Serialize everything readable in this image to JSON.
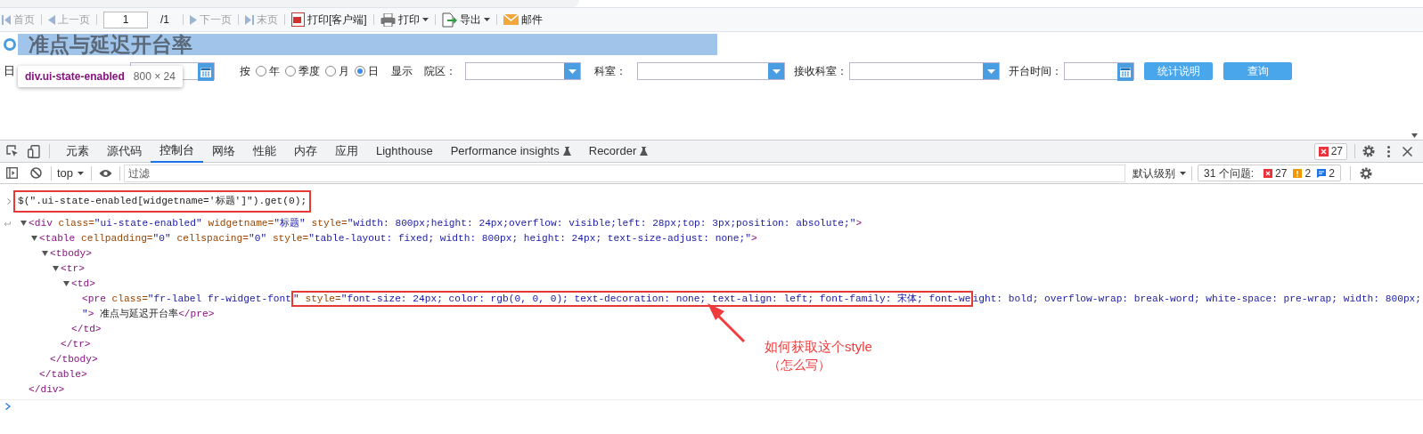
{
  "report_toolbar": {
    "items": [
      {
        "label": "首页",
        "disabled": true
      },
      {
        "label": "上一页",
        "disabled": true
      },
      {
        "kind": "page",
        "value": "1",
        "total": "/1"
      },
      {
        "label": "下一页",
        "disabled": true
      },
      {
        "label": "末页",
        "disabled": true
      },
      {
        "label": "打印[客户端]",
        "disabled": false
      },
      {
        "label": "打印",
        "disabled": false,
        "menu": true
      },
      {
        "label": "导出",
        "disabled": false,
        "menu": true
      },
      {
        "label": "邮件",
        "disabled": false
      }
    ]
  },
  "title": {
    "text": "准点与延迟开台率"
  },
  "tooltip": {
    "selector": "div.ui-state-enabled",
    "size": "800 × 24"
  },
  "filters": {
    "date_label": "日",
    "group_label": "按",
    "periods": [
      {
        "label": "年",
        "selected": false
      },
      {
        "label": "季度",
        "selected": false
      },
      {
        "label": "月",
        "selected": false
      },
      {
        "label": "日",
        "selected": true
      }
    ],
    "show_label": "显示",
    "campus_label": "院区：",
    "dept_label": "科室：",
    "recv_dept_label": "接收科室：",
    "time_label": "开台时间：",
    "buttons": [
      "统计说明",
      "查询"
    ]
  },
  "devtools": {
    "tabs": [
      {
        "label": "元素",
        "selected": false
      },
      {
        "label": "源代码",
        "selected": false
      },
      {
        "label": "控制台",
        "selected": true
      },
      {
        "label": "网络",
        "selected": false
      },
      {
        "label": "性能",
        "selected": false
      },
      {
        "label": "内存",
        "selected": false
      },
      {
        "label": "应用",
        "selected": false
      },
      {
        "label": "Lighthouse",
        "selected": false
      },
      {
        "label": "Performance insights",
        "selected": false,
        "flask": true
      },
      {
        "label": "Recorder",
        "selected": false,
        "flask": true
      }
    ],
    "error_count": "27",
    "context": "top",
    "filter_placeholder": "过滤",
    "level": "默认级别",
    "issues_label": "31 个问题:",
    "issue_errors": "27",
    "issue_warnings": "2",
    "issue_infos": "2"
  },
  "console": {
    "command": "$(\".ui-state-enabled[widgetname='标题']\").get(0);",
    "result": {
      "expanded": true,
      "lines": [
        [
          {
            "t": "<div",
            "kind": "tag"
          },
          {
            "t": " class=",
            "kind": "attr"
          },
          {
            "t": "\"ui-state-enabled\"",
            "kind": "value"
          },
          {
            "t": " widgetname=",
            "kind": "attr"
          },
          {
            "t": "\"标题\"",
            "kind": "value"
          },
          {
            "t": " style=",
            "kind": "attr"
          },
          {
            "t": "\"width: 800px;height: 24px;overflow: visible;left: 28px;top: 3px;position: absolute;\"",
            "kind": "value"
          },
          {
            "t": ">",
            "kind": "tag"
          }
        ]
      ],
      "children": [
        {
          "expanded": true,
          "lines": [
            [
              {
                "t": "<table",
                "kind": "tag"
              },
              {
                "t": " cellpadding=",
                "kind": "attr"
              },
              {
                "t": "\"0\"",
                "kind": "value"
              },
              {
                "t": " cellspacing=",
                "kind": "attr"
              },
              {
                "t": "\"0\"",
                "kind": "value"
              },
              {
                "t": " style=",
                "kind": "attr"
              },
              {
                "t": "\"table-layout: fixed; width: 800px; height: 24px; text-size-adjust: none;\"",
                "kind": "value"
              },
              {
                "t": ">",
                "kind": "tag"
              }
            ]
          ],
          "children": [
            {
              "expanded": true,
              "lines": [
                [
                  {
                    "t": "<tbody>",
                    "kind": "tag"
                  }
                ]
              ],
              "children": [
                {
                  "expanded": true,
                  "lines": [
                    [
                      {
                        "t": "<tr>",
                        "kind": "tag"
                      }
                    ]
                  ],
                  "children": [
                    {
                      "expanded": true,
                      "lines": [
                        [
                          {
                            "t": "<td>",
                            "kind": "tag"
                          }
                        ]
                      ],
                      "children": [
                        {
                          "lines": [
                            [
                              {
                                "t": "<pre",
                                "kind": "tag"
                              },
                              {
                                "t": " class=",
                                "kind": "attr"
                              },
                              {
                                "t": "\"fr-label fr-widget-font",
                                "kind": "value"
                              },
                              {
                                "t": "\"",
                                "kind": "value",
                                "boxed": true
                              },
                              {
                                "t": " style=",
                                "kind": "attr",
                                "boxed": true
                              },
                              {
                                "t": "\"font-size: 24px; color: rgb(0, 0, 0); text-decoration: none; text-align: left; font-family: 宋体; font-we",
                                "kind": "value",
                                "boxed": true
                              },
                              {
                                "t": "ight: bold; overflow-wrap: break-word; white-space: pre-wrap; width: 800px;",
                                "kind": "value"
                              }
                            ],
                            [
                              {
                                "t": "\"",
                                "kind": "value"
                              },
                              {
                                "t": ">",
                                "kind": "tag"
                              },
                              {
                                "t": " 准点与延迟开台率",
                                "kind": "text"
                              },
                              {
                                "t": "</pre>",
                                "kind": "tag"
                              }
                            ]
                          ]
                        }
                      ],
                      "close": "</td>"
                    }
                  ],
                  "close": "</tr>"
                }
              ],
              "close": "</tbody>"
            }
          ],
          "close": "</table>"
        }
      ],
      "close": "</div>"
    }
  },
  "annotation": {
    "lines": [
      "如何获取这个style",
      "（怎么写）"
    ]
  }
}
